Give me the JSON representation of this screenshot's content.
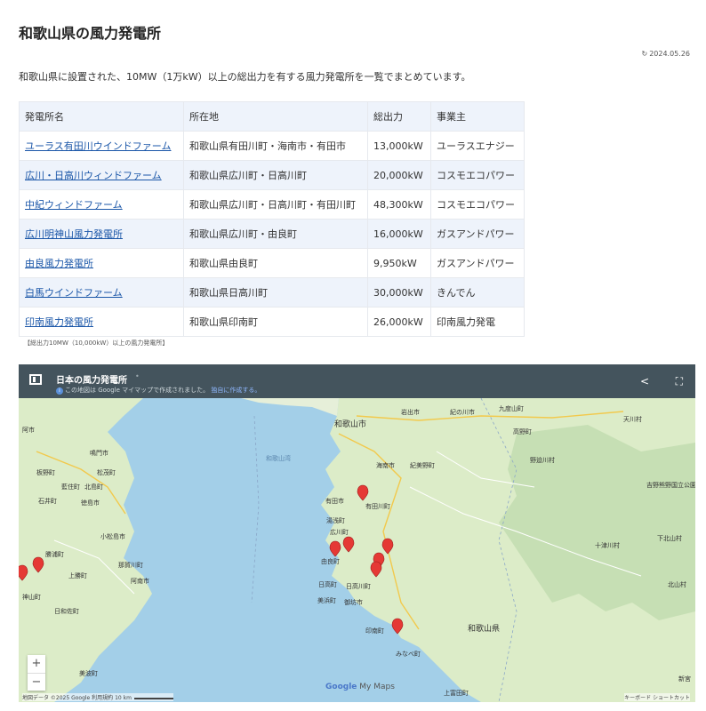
{
  "page": {
    "title": "和歌山県の風力発電所",
    "date": "2024.05.26",
    "intro": "和歌山県に設置された、10MW（1万kW）以上の総出力を有する風力発電所を一覧でまとめています。"
  },
  "table": {
    "headers": [
      "発電所名",
      "所在地",
      "総出力",
      "事業主"
    ],
    "rows": [
      {
        "name": "ユーラス有田川ウインドファーム",
        "location": "和歌山県有田川町・海南市・有田市",
        "output": "13,000kW",
        "operator": "ユーラスエナジー"
      },
      {
        "name": "広川・日高川ウィンドファーム",
        "location": "和歌山県広川町・日高川町",
        "output": "20,000kW",
        "operator": "コスモエコパワー"
      },
      {
        "name": "中紀ウィンドファーム",
        "location": "和歌山県広川町・日高川町・有田川町",
        "output": "48,300kW",
        "operator": "コスモエコパワー"
      },
      {
        "name": "広川明神山風力発電所",
        "location": "和歌山県広川町・由良町",
        "output": "16,000kW",
        "operator": "ガスアンドパワー"
      },
      {
        "name": "由良風力発電所",
        "location": "和歌山県由良町",
        "output": "9,950kW",
        "operator": "ガスアンドパワー"
      },
      {
        "name": "白馬ウインドファーム",
        "location": "和歌山県日高川町",
        "output": "30,000kW",
        "operator": "きんでん"
      },
      {
        "name": "印南風力発電所",
        "location": "和歌山県印南町",
        "output": "26,000kW",
        "operator": "印南風力発電"
      }
    ],
    "note": "【総出力10MW（10,000kW）以上の風力発電所】"
  },
  "map": {
    "title": "日本の風力発電所",
    "subtitle": "この地図は Google マイマップで作成されました。",
    "subtitle_link": "独自に作成する。",
    "attribution": "地図データ ©2025 Google",
    "terms": "利用規約",
    "scale": "10 km",
    "brand_google": "Google",
    "brand_mymaps": "My Maps",
    "shortcuts": "キーボード ショートカット",
    "zoom_in": "+",
    "zoom_out": "−",
    "marker_color": "#e53935",
    "labels": {
      "wakayama_city": "和歌山市",
      "wakayama_ken": "和歌山県",
      "wakayama_bay": "和歌山湾",
      "iwade": "岩出市",
      "kinokawa": "紀の川市",
      "kudoyama": "九度山町",
      "tenkawa": "天川村",
      "koya": "高野町",
      "nosegawa": "野迫川村",
      "yoshino": "吉野熊野国立公園",
      "totsukawa": "十津川村",
      "shimokitayama": "下北山村",
      "kitayama": "北山村",
      "kainan": "海南市",
      "kimino": "紀美野町",
      "arida": "有田市",
      "aridagawa": "有田川町",
      "yuasa": "湯浅町",
      "hirogawa": "広川町",
      "yura": "由良町",
      "hidaka": "日高町",
      "hidakagawa": "日高川町",
      "mihama": "美浜町",
      "gobo": "御坊市",
      "inami": "印南町",
      "minabe": "みなべ町",
      "kamitonda": "上富田町",
      "shingu": "新宮",
      "naruto": "鳴門市",
      "matsushige": "松茂町",
      "kitajima": "北島町",
      "itano": "板野町",
      "aizumi": "藍住町",
      "ishii": "石井町",
      "tokushima": "徳島市",
      "matsushima": "小松島市",
      "nakagawa": "那賀川町",
      "anan": "阿南市",
      "katsuura": "勝浦町",
      "kamikatsu": "上勝町",
      "kamiyama": "神山町",
      "minami": "美波町",
      "hiwasa": "日和佐町",
      "akita": "阿市"
    }
  }
}
